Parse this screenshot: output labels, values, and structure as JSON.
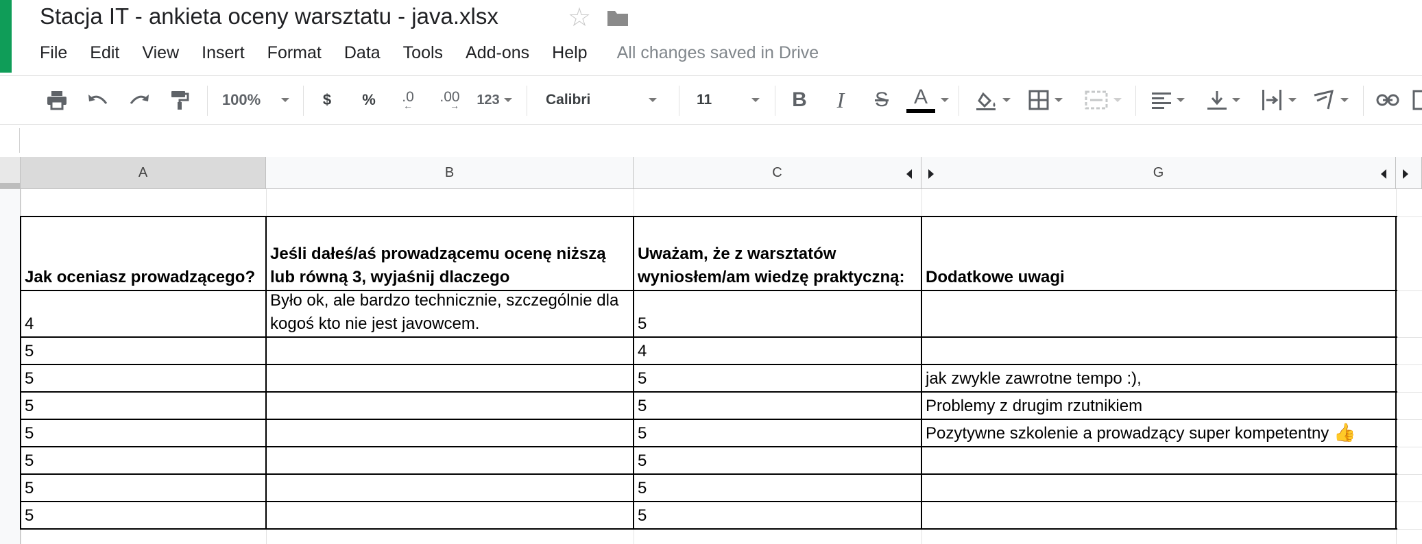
{
  "document": {
    "title": "Stacja IT - ankieta oceny warsztatu - java.xlsx"
  },
  "menu": {
    "items": [
      "File",
      "Edit",
      "View",
      "Insert",
      "Format",
      "Data",
      "Tools",
      "Add-ons",
      "Help"
    ],
    "status": "All changes saved in Drive"
  },
  "toolbar": {
    "zoom": "100%",
    "currency_label": "$",
    "percent_label": "%",
    "decrease_decimals_label": ".0",
    "increase_decimals_label": ".00",
    "more_formats_label": "123",
    "font": "Calibri",
    "font_size": "11",
    "bold_label": "B",
    "italic_label": "I",
    "strike_label": "S",
    "text_color_label": "A",
    "text_color": "#000000"
  },
  "formula_bar": {
    "value": ""
  },
  "columns": [
    "A",
    "B",
    "C",
    "G"
  ],
  "sheet": {
    "headers": [
      "Jak oceniasz prowadzącego?",
      "Jeśli dałeś/aś prowadzącemu ocenę niższą lub równą 3, wyjaśnij dlaczego",
      "Uważam, że z warsztatów wyniosłem/am wiedzę praktyczną:",
      "Dodatkowe uwagi"
    ],
    "rows": [
      [
        "4",
        "Było ok, ale bardzo technicznie, szczególnie dla kogoś kto nie jest javowcem.",
        "5",
        ""
      ],
      [
        "5",
        "",
        "4",
        ""
      ],
      [
        "5",
        "",
        "5",
        "jak zwykle zawrotne tempo :),"
      ],
      [
        "5",
        "",
        "5",
        "Problemy z drugim rzutnikiem"
      ],
      [
        "5",
        "",
        "5",
        "Pozytywne szkolenie a prowadzący super kompetentny 👍"
      ],
      [
        "5",
        "",
        "5",
        ""
      ],
      [
        "5",
        "",
        "5",
        ""
      ],
      [
        "5",
        "",
        "5",
        ""
      ]
    ]
  },
  "colors": {
    "brand_green": "#0f9d58",
    "selected_column_header": "#dadada"
  }
}
